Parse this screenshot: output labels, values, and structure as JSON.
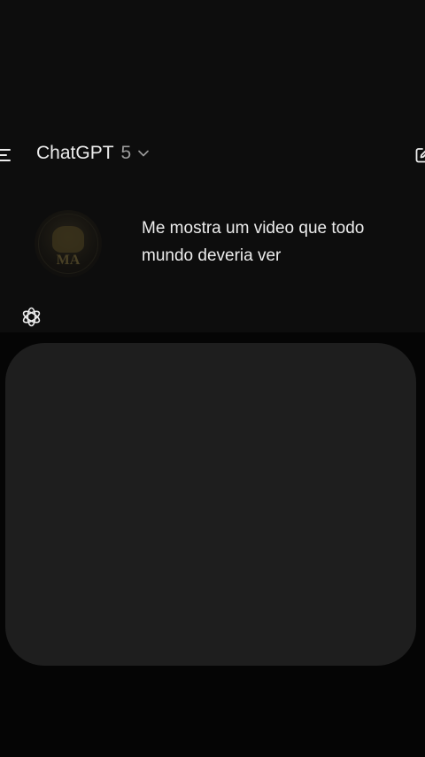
{
  "header": {
    "title": "ChatGPT",
    "model_version": "5",
    "menu_icon": "menu-icon",
    "new_chat_icon": "new-chat-icon",
    "dropdown_icon": "chevron-down-icon"
  },
  "conversation": {
    "user_message": "Me mostra um video que todo mundo deveria ver",
    "user_avatar_monogram": "MA",
    "assistant_icon": "openai-logo-icon"
  },
  "colors": {
    "background": "#0d0d0d",
    "text": "#ececec",
    "muted": "#9a9a9a",
    "card": "#1e1e1e"
  }
}
